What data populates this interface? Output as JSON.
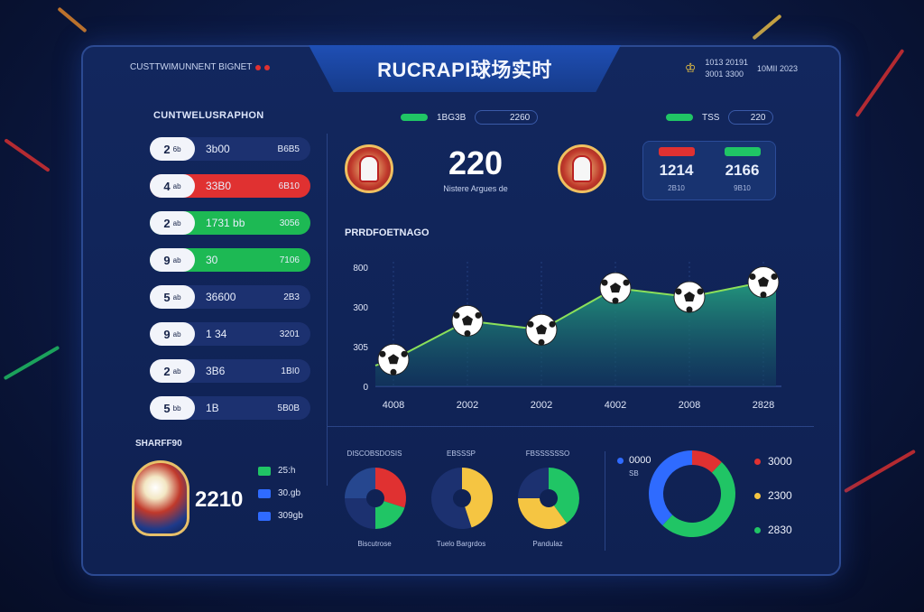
{
  "header": {
    "title": "RUCRAPI球场实时",
    "brand": "CUSTTWIMUNNENT BIGNET",
    "top_right": [
      "1013 20191",
      "3001 3300",
      "10MII 2023"
    ]
  },
  "rankings": {
    "label": "CUNTWELUSRAPHON",
    "rows": [
      {
        "rank": "2",
        "code": "6b",
        "mid": "3b00",
        "right": "B6B5",
        "style": "dark"
      },
      {
        "rank": "4",
        "code": "ab",
        "mid": "33B0",
        "right": "6B10",
        "style": "red"
      },
      {
        "rank": "2",
        "code": "ab",
        "mid": "1731 bb",
        "right": "3056",
        "style": "green"
      },
      {
        "rank": "9",
        "code": "ab",
        "mid": "30",
        "right": "7106",
        "style": "green"
      },
      {
        "rank": "5",
        "code": "ab",
        "mid": "36600",
        "right": "2B3",
        "style": "dark"
      },
      {
        "rank": "9",
        "code": "ab",
        "mid": "1 34",
        "right": "3201",
        "style": "dark"
      },
      {
        "rank": "2",
        "code": "ab",
        "mid": "3B6",
        "right": "1BI0",
        "style": "dark"
      },
      {
        "rank": "5",
        "code": "bb",
        "mid": "1B",
        "right": "5B0B",
        "style": "dark"
      }
    ]
  },
  "match": {
    "score": "220",
    "subtitle": "Nistere Argues de",
    "left_bar": {
      "label": "1BG3B",
      "value": "2260"
    },
    "right_bar": {
      "label": "TSS",
      "value": "220"
    }
  },
  "stats": {
    "left": {
      "value": "1214",
      "label": "2B10",
      "tag_color": "#e03131"
    },
    "right": {
      "value": "2166",
      "label": "9B10",
      "tag_color": "#20c565"
    }
  },
  "chart_data": {
    "type": "area",
    "title": "PRRDFOETNAGO",
    "x": [
      "4008",
      "2002",
      "2002",
      "4002",
      "2008",
      "2828"
    ],
    "y_ticks": [
      "0",
      "305",
      "300",
      "800"
    ],
    "values": [
      45,
      110,
      95,
      165,
      150,
      175
    ],
    "ylim": [
      0,
      200
    ],
    "grid": true,
    "colors": {
      "line": "#8be05a",
      "fill": "#1e7a6a"
    }
  },
  "trophy": {
    "label": "SHARFF90",
    "value": "2210",
    "legend": [
      {
        "value": "25:h",
        "color": "#20c565"
      },
      {
        "value": "30.gb",
        "color": "#2f6bff"
      },
      {
        "value": "309gb",
        "color": "#2f6bff"
      }
    ]
  },
  "donuts": [
    {
      "title": "DISCOBSDOSIS",
      "footer": "Biscutrose",
      "slices": [
        {
          "v": 30,
          "c": "#e03131"
        },
        {
          "v": 20,
          "c": "#20c565"
        },
        {
          "v": 25,
          "c": "#1c3170"
        },
        {
          "v": 25,
          "c": "#26478f"
        }
      ]
    },
    {
      "title": "EBSSSP",
      "footer": "Tuelo Bargrdos",
      "slices": [
        {
          "v": 45,
          "c": "#f5c542"
        },
        {
          "v": 55,
          "c": "#1c3170"
        }
      ]
    },
    {
      "title": "FBSSSSSSO",
      "footer": "Pandulaz",
      "slices": [
        {
          "v": 40,
          "c": "#20c565"
        },
        {
          "v": 35,
          "c": "#f5c542"
        },
        {
          "v": 25,
          "c": "#1c3170"
        }
      ]
    }
  ],
  "main_donut": {
    "legend_top": {
      "value": "0000",
      "sub": "SB",
      "color": "#2f6bff"
    },
    "legend": [
      {
        "value": "3000",
        "color": "#e03131"
      },
      {
        "value": "2300",
        "color": "#f5c542"
      },
      {
        "value": "2830",
        "color": "#20c565"
      }
    ],
    "slices": [
      {
        "v": 12,
        "c": "#e03131"
      },
      {
        "v": 50,
        "c": "#20c565"
      },
      {
        "v": 38,
        "c": "#2f6bff"
      }
    ]
  }
}
